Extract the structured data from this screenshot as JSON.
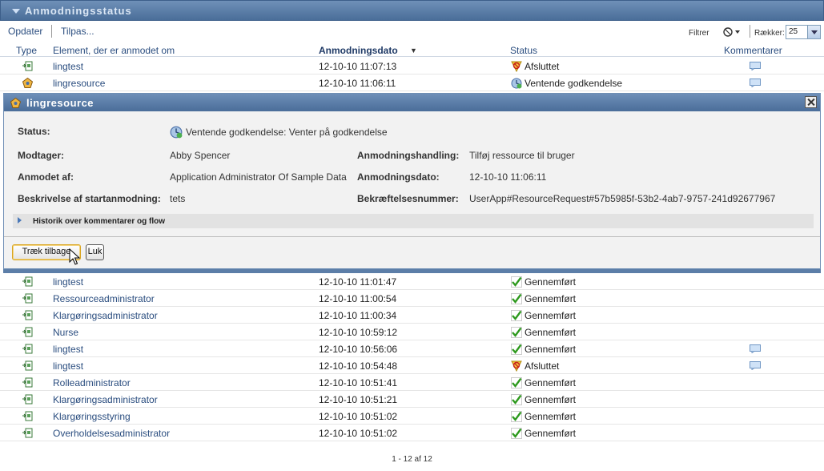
{
  "panel": {
    "title": "Anmodningsstatus"
  },
  "toolbar": {
    "refresh": "Opdater",
    "customize": "Tilpas...",
    "filter": "Filtrer",
    "rows_label": "Rækker:",
    "rows_value": "25"
  },
  "columns": {
    "type": "Type",
    "item": "Element, der er anmodet om",
    "date": "Anmodningsdato",
    "status": "Status",
    "comments": "Kommentarer"
  },
  "top_rows": [
    {
      "type_icon": "workflow-icon",
      "name": "lingtest",
      "date": "12-10-10 11:07:13",
      "status": "Afsluttet",
      "status_icon": "terminated-icon",
      "comment": true
    },
    {
      "type_icon": "resource-icon",
      "name": "lingresource",
      "date": "12-10-10 11:06:11",
      "status": "Ventende godkendelse",
      "status_icon": "pending-icon",
      "comment": true
    }
  ],
  "detail": {
    "title": "lingresource",
    "status_label": "Status:",
    "status_value": "Ventende godkendelse: Venter på godkendelse",
    "recipient_label": "Modtager:",
    "recipient_value": "Abby Spencer",
    "requested_by_label": "Anmodet af:",
    "requested_by_value": "Application Administrator Of Sample Data",
    "desc_label": "Beskrivelse af startanmodning:",
    "desc_value": "tets",
    "action_label": "Anmodningshandling:",
    "action_value": "Tilføj ressource til bruger",
    "date_label": "Anmodningsdato:",
    "date_value": "12-10-10 11:06:11",
    "confirm_label": "Bekræftelsesnummer:",
    "confirm_value": "UserApp#ResourceRequest#57b5985f-53b2-4ab7-9757-241d92677967",
    "history_label": "Historik over kommentarer og flow",
    "retract_button": "Træk tilbage",
    "close_button": "Luk"
  },
  "bottom_rows": [
    {
      "name": "lingtest",
      "date": "12-10-10 11:01:47",
      "status": "Gennemført",
      "status_icon": "check-icon",
      "comment": false
    },
    {
      "name": "Ressourceadministrator",
      "date": "12-10-10 11:00:54",
      "status": "Gennemført",
      "status_icon": "check-icon",
      "comment": false
    },
    {
      "name": "Klargøringsadministrator",
      "date": "12-10-10 11:00:34",
      "status": "Gennemført",
      "status_icon": "check-icon",
      "comment": false
    },
    {
      "name": "Nurse",
      "date": "12-10-10 10:59:12",
      "status": "Gennemført",
      "status_icon": "check-icon",
      "comment": false
    },
    {
      "name": "lingtest",
      "date": "12-10-10 10:56:06",
      "status": "Gennemført",
      "status_icon": "check-icon",
      "comment": true
    },
    {
      "name": "lingtest",
      "date": "12-10-10 10:54:48",
      "status": "Afsluttet",
      "status_icon": "terminated-icon",
      "comment": true
    },
    {
      "name": "Rolleadministrator",
      "date": "12-10-10 10:51:41",
      "status": "Gennemført",
      "status_icon": "check-icon",
      "comment": false
    },
    {
      "name": "Klargøringsadministrator",
      "date": "12-10-10 10:51:21",
      "status": "Gennemført",
      "status_icon": "check-icon",
      "comment": false
    },
    {
      "name": "Klargøringsstyring",
      "date": "12-10-10 10:51:02",
      "status": "Gennemført",
      "status_icon": "check-icon",
      "comment": false
    },
    {
      "name": "Overholdelsesadministrator",
      "date": "12-10-10 10:51:02",
      "status": "Gennemført",
      "status_icon": "check-icon",
      "comment": false
    }
  ],
  "footer": {
    "pagination": "1 - 12 af 12"
  },
  "colors": {
    "header_blue": "#4a6e99",
    "link_blue": "#2a4d7f",
    "check_green": "#2f9a1f"
  }
}
